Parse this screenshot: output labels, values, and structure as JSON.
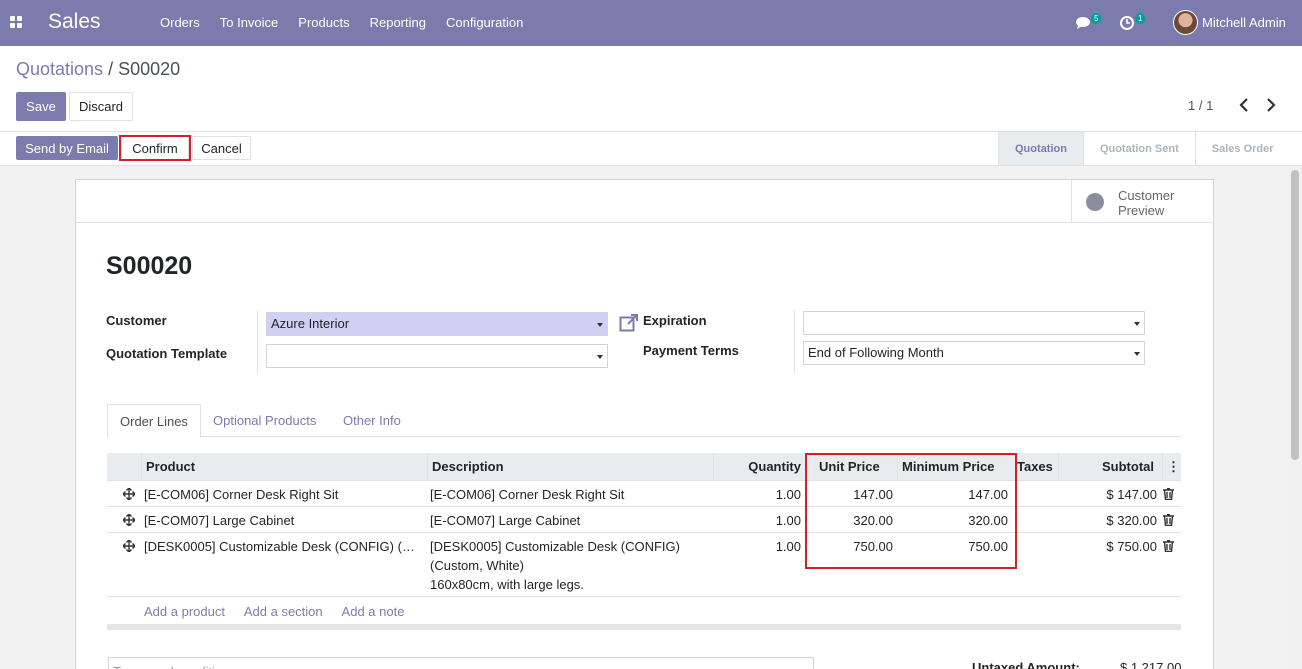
{
  "navbar": {
    "brand": "Sales",
    "menu": [
      "Orders",
      "To Invoice",
      "Products",
      "Reporting",
      "Configuration"
    ],
    "chat_count": "5",
    "activity_count": "1",
    "user": "Mitchell Admin"
  },
  "breadcrumb": {
    "parent": "Quotations",
    "separator": " / ",
    "current": "S00020"
  },
  "buttons": {
    "save": "Save",
    "discard": "Discard",
    "send_email": "Send by Email",
    "confirm": "Confirm",
    "cancel": "Cancel"
  },
  "pager": {
    "value": "1 / 1"
  },
  "stages": [
    {
      "label": "Quotation",
      "active": true
    },
    {
      "label": "Quotation Sent",
      "active": false
    },
    {
      "label": "Sales Order",
      "active": false
    }
  ],
  "smart_button": {
    "label": "Customer Preview"
  },
  "record": {
    "name": "S00020",
    "customer_label": "Customer",
    "customer_value": "Azure Interior",
    "template_label": "Quotation Template",
    "template_value": "",
    "expiration_label": "Expiration",
    "expiration_value": "",
    "payment_terms_label": "Payment Terms",
    "payment_terms_value": "End of Following Month"
  },
  "tabs": [
    "Order Lines",
    "Optional Products",
    "Other Info"
  ],
  "table": {
    "columns": [
      "Product",
      "Description",
      "Quantity",
      "Unit Price",
      "Minimum Price",
      "Taxes",
      "Subtotal"
    ],
    "rows": [
      {
        "product": "[E-COM06] Corner Desk Right Sit",
        "description": [
          "[E-COM06] Corner Desk Right Sit"
        ],
        "quantity": "1.00",
        "unit_price": "147.00",
        "min_price": "147.00",
        "taxes": "",
        "subtotal": "$ 147.00"
      },
      {
        "product": "[E-COM07] Large Cabinet",
        "description": [
          "[E-COM07] Large Cabinet"
        ],
        "quantity": "1.00",
        "unit_price": "320.00",
        "min_price": "320.00",
        "taxes": "",
        "subtotal": "$ 320.00"
      },
      {
        "product": "[DESK0005] Customizable Desk (CONFIG) (…",
        "description": [
          "[DESK0005] Customizable Desk (CONFIG)",
          "(Custom, White)",
          "160x80cm, with large legs."
        ],
        "quantity": "1.00",
        "unit_price": "750.00",
        "min_price": "750.00",
        "taxes": "",
        "subtotal": "$ 750.00"
      }
    ]
  },
  "add_links": [
    "Add a product",
    "Add a section",
    "Add a note"
  ],
  "terms_placeholder": "Terms and conditions...",
  "totals": {
    "untaxed_label": "Untaxed Amount:",
    "untaxed_value": "$ 1,217.00"
  },
  "colors": {
    "primary": "#7c7bad",
    "highlight": "#d0202a",
    "badge": "#00a09d"
  }
}
